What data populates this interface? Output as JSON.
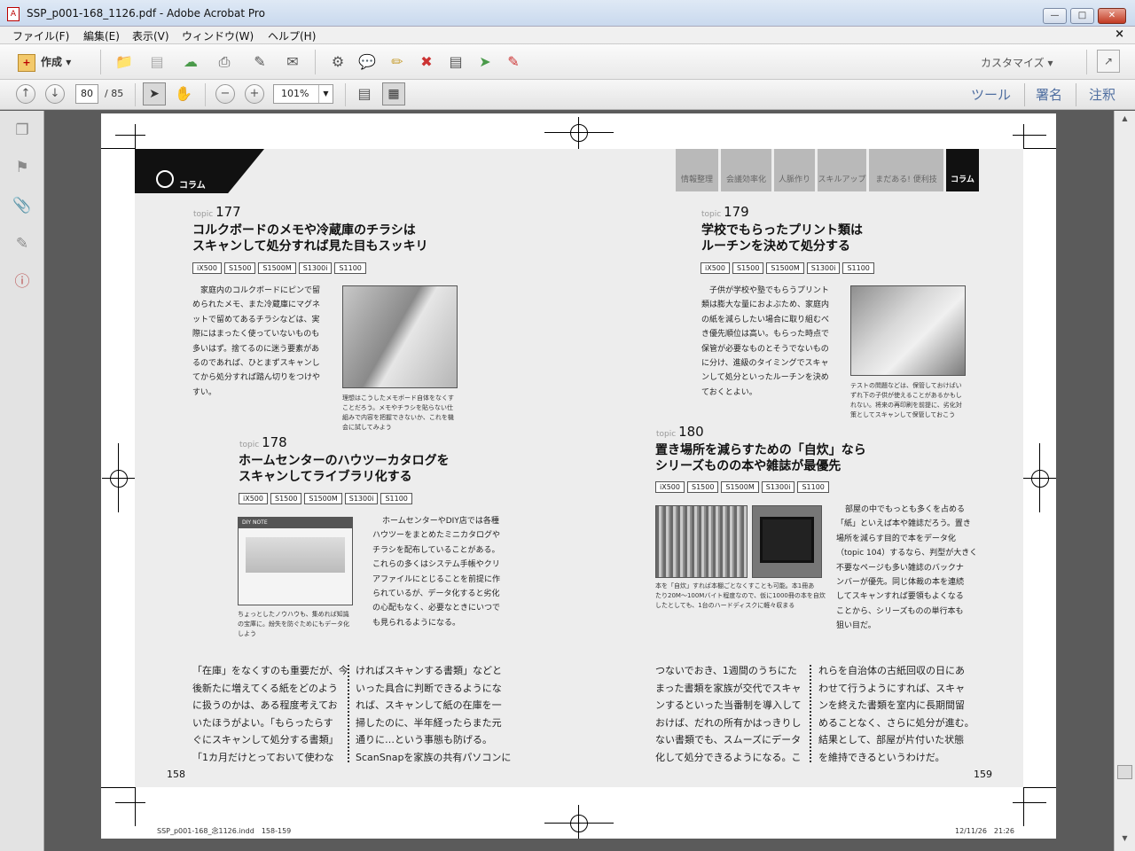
{
  "window": {
    "title": "SSP_p001-168_1126.pdf - Adobe Acrobat Pro",
    "app_icon": "pdf-icon",
    "controls": [
      "minimize",
      "maximize",
      "close"
    ]
  },
  "menu": {
    "items": [
      "ファイル(F)",
      "編集(E)",
      "表示(V)",
      "ウィンドウ(W)",
      "ヘルプ(H)"
    ],
    "close_glyph": "×"
  },
  "toolbar": {
    "create_label": "作成",
    "customize_label": "カスタマイズ",
    "icons": [
      "open-icon",
      "save-icon",
      "upload-icon",
      "print-icon",
      "edit-icon",
      "email-icon",
      "settings-icon",
      "comment-icon",
      "highlight-icon",
      "delete-icon",
      "stamp-icon",
      "export-icon",
      "sign-icon"
    ]
  },
  "navbar": {
    "current_page": "80",
    "total_pages": "/ 85",
    "zoom": "101%",
    "tabs": [
      "ツール",
      "署名",
      "注釈"
    ]
  },
  "left_panel": {
    "icons": [
      "pages-icon",
      "bookmark-icon",
      "attachment-icon",
      "signature-icon",
      "info-icon"
    ]
  },
  "document": {
    "left_header": "コラム",
    "nav_tabs": [
      "情報整理",
      "会議効率化",
      "人脈作り",
      "スキルアップ",
      "まだある! 便利技",
      "コラム"
    ],
    "topics": [
      {
        "label": "topic",
        "num": "177",
        "title1": "コルクボードのメモや冷蔵庫のチラシは",
        "title2": "スキャンして処分すれば見た目もスッキリ",
        "tags": [
          "iX500",
          "S1500",
          "S1500M",
          "S1300i",
          "S1100"
        ],
        "body": [
          "家庭内のコルクボードにピンで留",
          "められたメモ、また冷蔵庫にマグネ",
          "ットで留めてあるチラシなどは、実",
          "際にはまったく使っていないものも",
          "多いはず。捨てるのに迷う要素があ",
          "るのであれば、ひとまずスキャンし",
          "てから処分すれば踏ん切りをつけや",
          "すい。"
        ],
        "caption": [
          "理想はこうしたメモボード自体をなくす",
          "ことだろう。メモやチラシを貼らない仕",
          "組みで内容を把握できないか、これを機",
          "会に試してみよう"
        ]
      },
      {
        "label": "topic",
        "num": "178",
        "title1": "ホームセンターのハウツーカタログを",
        "title2": "スキャンしてライブラリ化する",
        "tags": [
          "iX500",
          "S1500",
          "S1500M",
          "S1300i",
          "S1100"
        ],
        "body": [
          "ホームセンターやDIY店では各種",
          "ハウツーをまとめたミニカタログや",
          "チラシを配布していることがある。",
          "これらの多くはシステム手帳やクリ",
          "アファイルにとじることを前提に作",
          "られているが、データ化すると劣化",
          "の心配もなく、必要なときにいつで",
          "も見られるようになる。"
        ],
        "caption": [
          "ちょっとしたノウハウも、集めれば知識",
          "の宝庫に。紛失を防ぐためにもデータ化",
          "しよう"
        ],
        "photo_text": "DIY NOTE"
      },
      {
        "label": "topic",
        "num": "179",
        "title1": "学校でもらったプリント類は",
        "title2": "ルーチンを決めて処分する",
        "tags": [
          "iX500",
          "S1500",
          "S1500M",
          "S1300i",
          "S1100"
        ],
        "body": [
          "子供が学校や塾でもらうプリント",
          "類は膨大な量におよぶため、家庭内",
          "の紙を減らしたい場合に取り組むべ",
          "き優先順位は高い。もらった時点で",
          "保管が必要なものとそうでないもの",
          "に分け、進級のタイミングでスキャ",
          "ンして処分といったルーチンを決め",
          "ておくとよい。"
        ],
        "caption": [
          "テストの問題などは、保管しておけばい",
          "ずれ下の子供が使えることがあるかもし",
          "れない。将来の再印刷を前提に、劣化対",
          "策としてスキャンして保管しておこう"
        ]
      },
      {
        "label": "topic",
        "num": "180",
        "title1": "置き場所を減らすための「自炊」なら",
        "title2": "シリーズものの本や雑誌が最優先",
        "tags": [
          "iX500",
          "S1500",
          "S1500M",
          "S1300i",
          "S1100"
        ],
        "body": [
          "部屋の中でもっとも多くを占める",
          "「紙」といえば本や雑誌だろう。置き",
          "場所を減らす目的で本をデータ化",
          "（topic 104）するなら、判型が大きく",
          "不要なページも多い雑誌のバックナ",
          "ンバーが優先。同じ体裁の本を連続",
          "してスキャンすれば要領もよくなる",
          "ことから、シリーズものの単行本も",
          "狙い目だ。"
        ],
        "caption": [
          "本を「自炊」すれば本棚ごとなくすことも可能。本1冊あ",
          "たり20M～100Mバイト程度なので、仮に1000冊の本を自炊",
          "したとしても、1台のハードディスクに軽々収まる"
        ]
      }
    ],
    "bottom_left_col1": [
      "「在庫」をなくすのも重要だが、今",
      "後新たに増えてくる紙をどのよう",
      "に扱うのかは、ある程度考えてお",
      "いたほうがよい。「もらったらす",
      "ぐにスキャンして処分する書類」",
      "「1カ月だけとっておいて使わな"
    ],
    "bottom_left_col2": [
      "ければスキャンする書類」などと",
      "いった具合に判断できるようにな",
      "れば、スキャンして紙の在庫を一",
      "掃したのに、半年経ったらまた元",
      "通りに…という事態も防げる。",
      "ScanSnapを家族の共有パソコンに"
    ],
    "bottom_right_col1": [
      "つないでおき、1週間のうちにた",
      "まった書類を家族が交代でスキャ",
      "ンするといった当番制を導入して",
      "おけば、だれの所有かはっきりし",
      "ない書類でも、スムーズにデータ",
      "化して処分できるようになる。こ"
    ],
    "bottom_right_col2": [
      "れらを自治体の古紙回収の日にあ",
      "わせて行うようにすれば、スキャ",
      "ンを終えた書類を室内に長期間留",
      "めることなく、さらに処分が進む。",
      "結果として、部屋が片付いた状態",
      "を維持できるというわけだ。"
    ],
    "page_left": "158",
    "page_right": "159",
    "slug_left": "SSP_p001-168_念1126.indd　158-159",
    "slug_right": "12/11/26　21:26"
  }
}
